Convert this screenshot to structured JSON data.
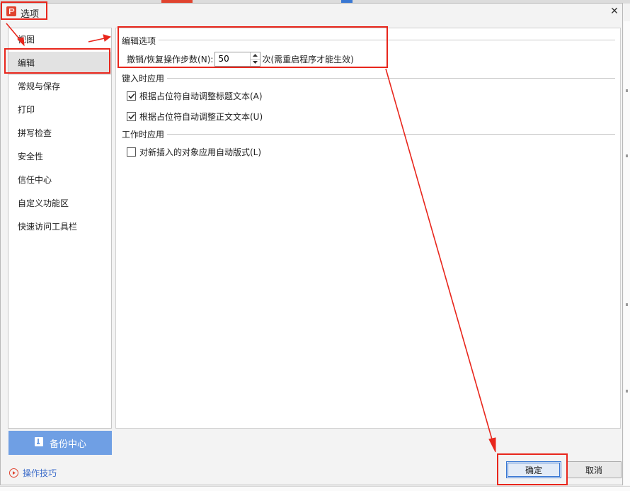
{
  "window": {
    "title": "选项",
    "close_glyph": "✕",
    "app_icon": "presentation-app-icon"
  },
  "sidebar": {
    "items": [
      {
        "label": "视图",
        "selected": false
      },
      {
        "label": "编辑",
        "selected": true
      },
      {
        "label": "常规与保存",
        "selected": false
      },
      {
        "label": "打印",
        "selected": false
      },
      {
        "label": "拼写检查",
        "selected": false
      },
      {
        "label": "安全性",
        "selected": false
      },
      {
        "label": "信任中心",
        "selected": false
      },
      {
        "label": "自定义功能区",
        "selected": false
      },
      {
        "label": "快速访问工具栏",
        "selected": false
      }
    ],
    "backup_label": "备份中心",
    "tips_label": "操作技巧"
  },
  "edit_options": {
    "title": "编辑选项",
    "undo_label": "撤销/恢复操作步数(N):",
    "undo_value": "50",
    "undo_suffix": "次(需重启程序才能生效)"
  },
  "typing_apply": {
    "title": "键入时应用",
    "checks": [
      {
        "label": "根据占位符自动调整标题文本(A)",
        "checked": true
      },
      {
        "label": "根据占位符自动调整正文文本(U)",
        "checked": true
      }
    ]
  },
  "work_apply": {
    "title": "工作时应用",
    "checks": [
      {
        "label": "对新插入的对象应用自动版式(L)",
        "checked": false
      }
    ]
  },
  "buttons": {
    "ok_label": "确定",
    "cancel_label": "取消"
  },
  "colors": {
    "accent_blue": "#6f9fe4",
    "annotation_red": "#e8261c",
    "brand_red": "#e0432f"
  }
}
